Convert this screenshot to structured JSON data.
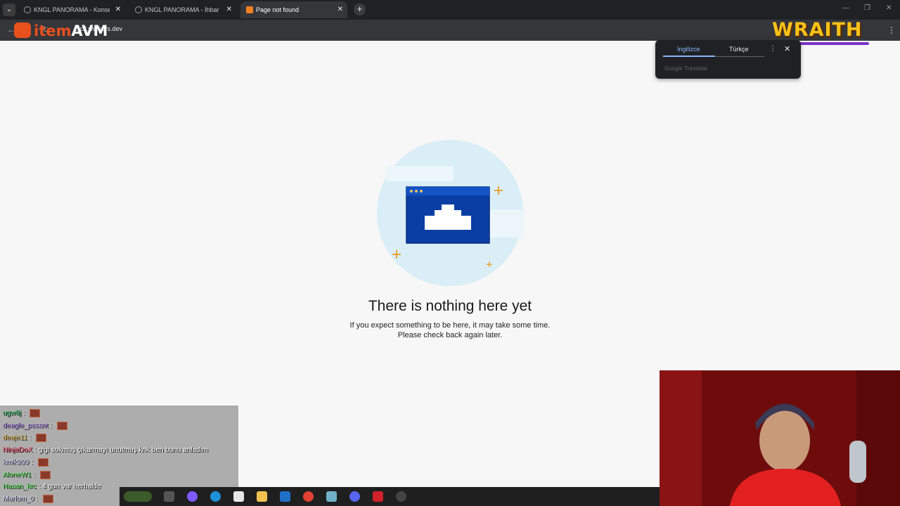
{
  "browser": {
    "tabs": [
      {
        "title": "KNGL PANORAMA - Konsey Ad",
        "active": false
      },
      {
        "title": "KNGL PANORAMA - İhbar Hattı",
        "active": false
      },
      {
        "title": "Page not found",
        "active": true
      }
    ],
    "url": "...c3.workers.dev"
  },
  "overlay": {
    "logo_prefix": "item",
    "logo_suffix": "AVM",
    "wraith": "WRAITH"
  },
  "translate_popup": {
    "source_lang": "İngilizce",
    "target_lang": "Türkçe",
    "brand": "Google Translate"
  },
  "page": {
    "heading": "There is nothing here yet",
    "line1": "If you expect something to be here, it may take some time.",
    "line2": "Please check back again later."
  },
  "chat": [
    {
      "user": "ugw8j",
      "text": "",
      "color": "#3ec46d"
    },
    {
      "user": "deagle_psssnt",
      "text": "",
      "color": "#b38cf0"
    },
    {
      "user": "deaje11",
      "text": "",
      "color": "#e8c25a"
    },
    {
      "user": "NinjaDoX",
      "text": "gigi sokmuş çıkarmayı unutmuş knk ben bunu anladım",
      "color": "#ff4f6f"
    },
    {
      "user": "kmik999",
      "text": "",
      "color": "#d7d7ff"
    },
    {
      "user": "AloneW1",
      "text": "",
      "color": "#5ef05e"
    },
    {
      "user": "Hasan_krc",
      "text": "4 gun var herhalde",
      "color": "#5ef05e"
    },
    {
      "user": "Marlom_0",
      "text": "",
      "color": "#d7d7ff"
    }
  ]
}
